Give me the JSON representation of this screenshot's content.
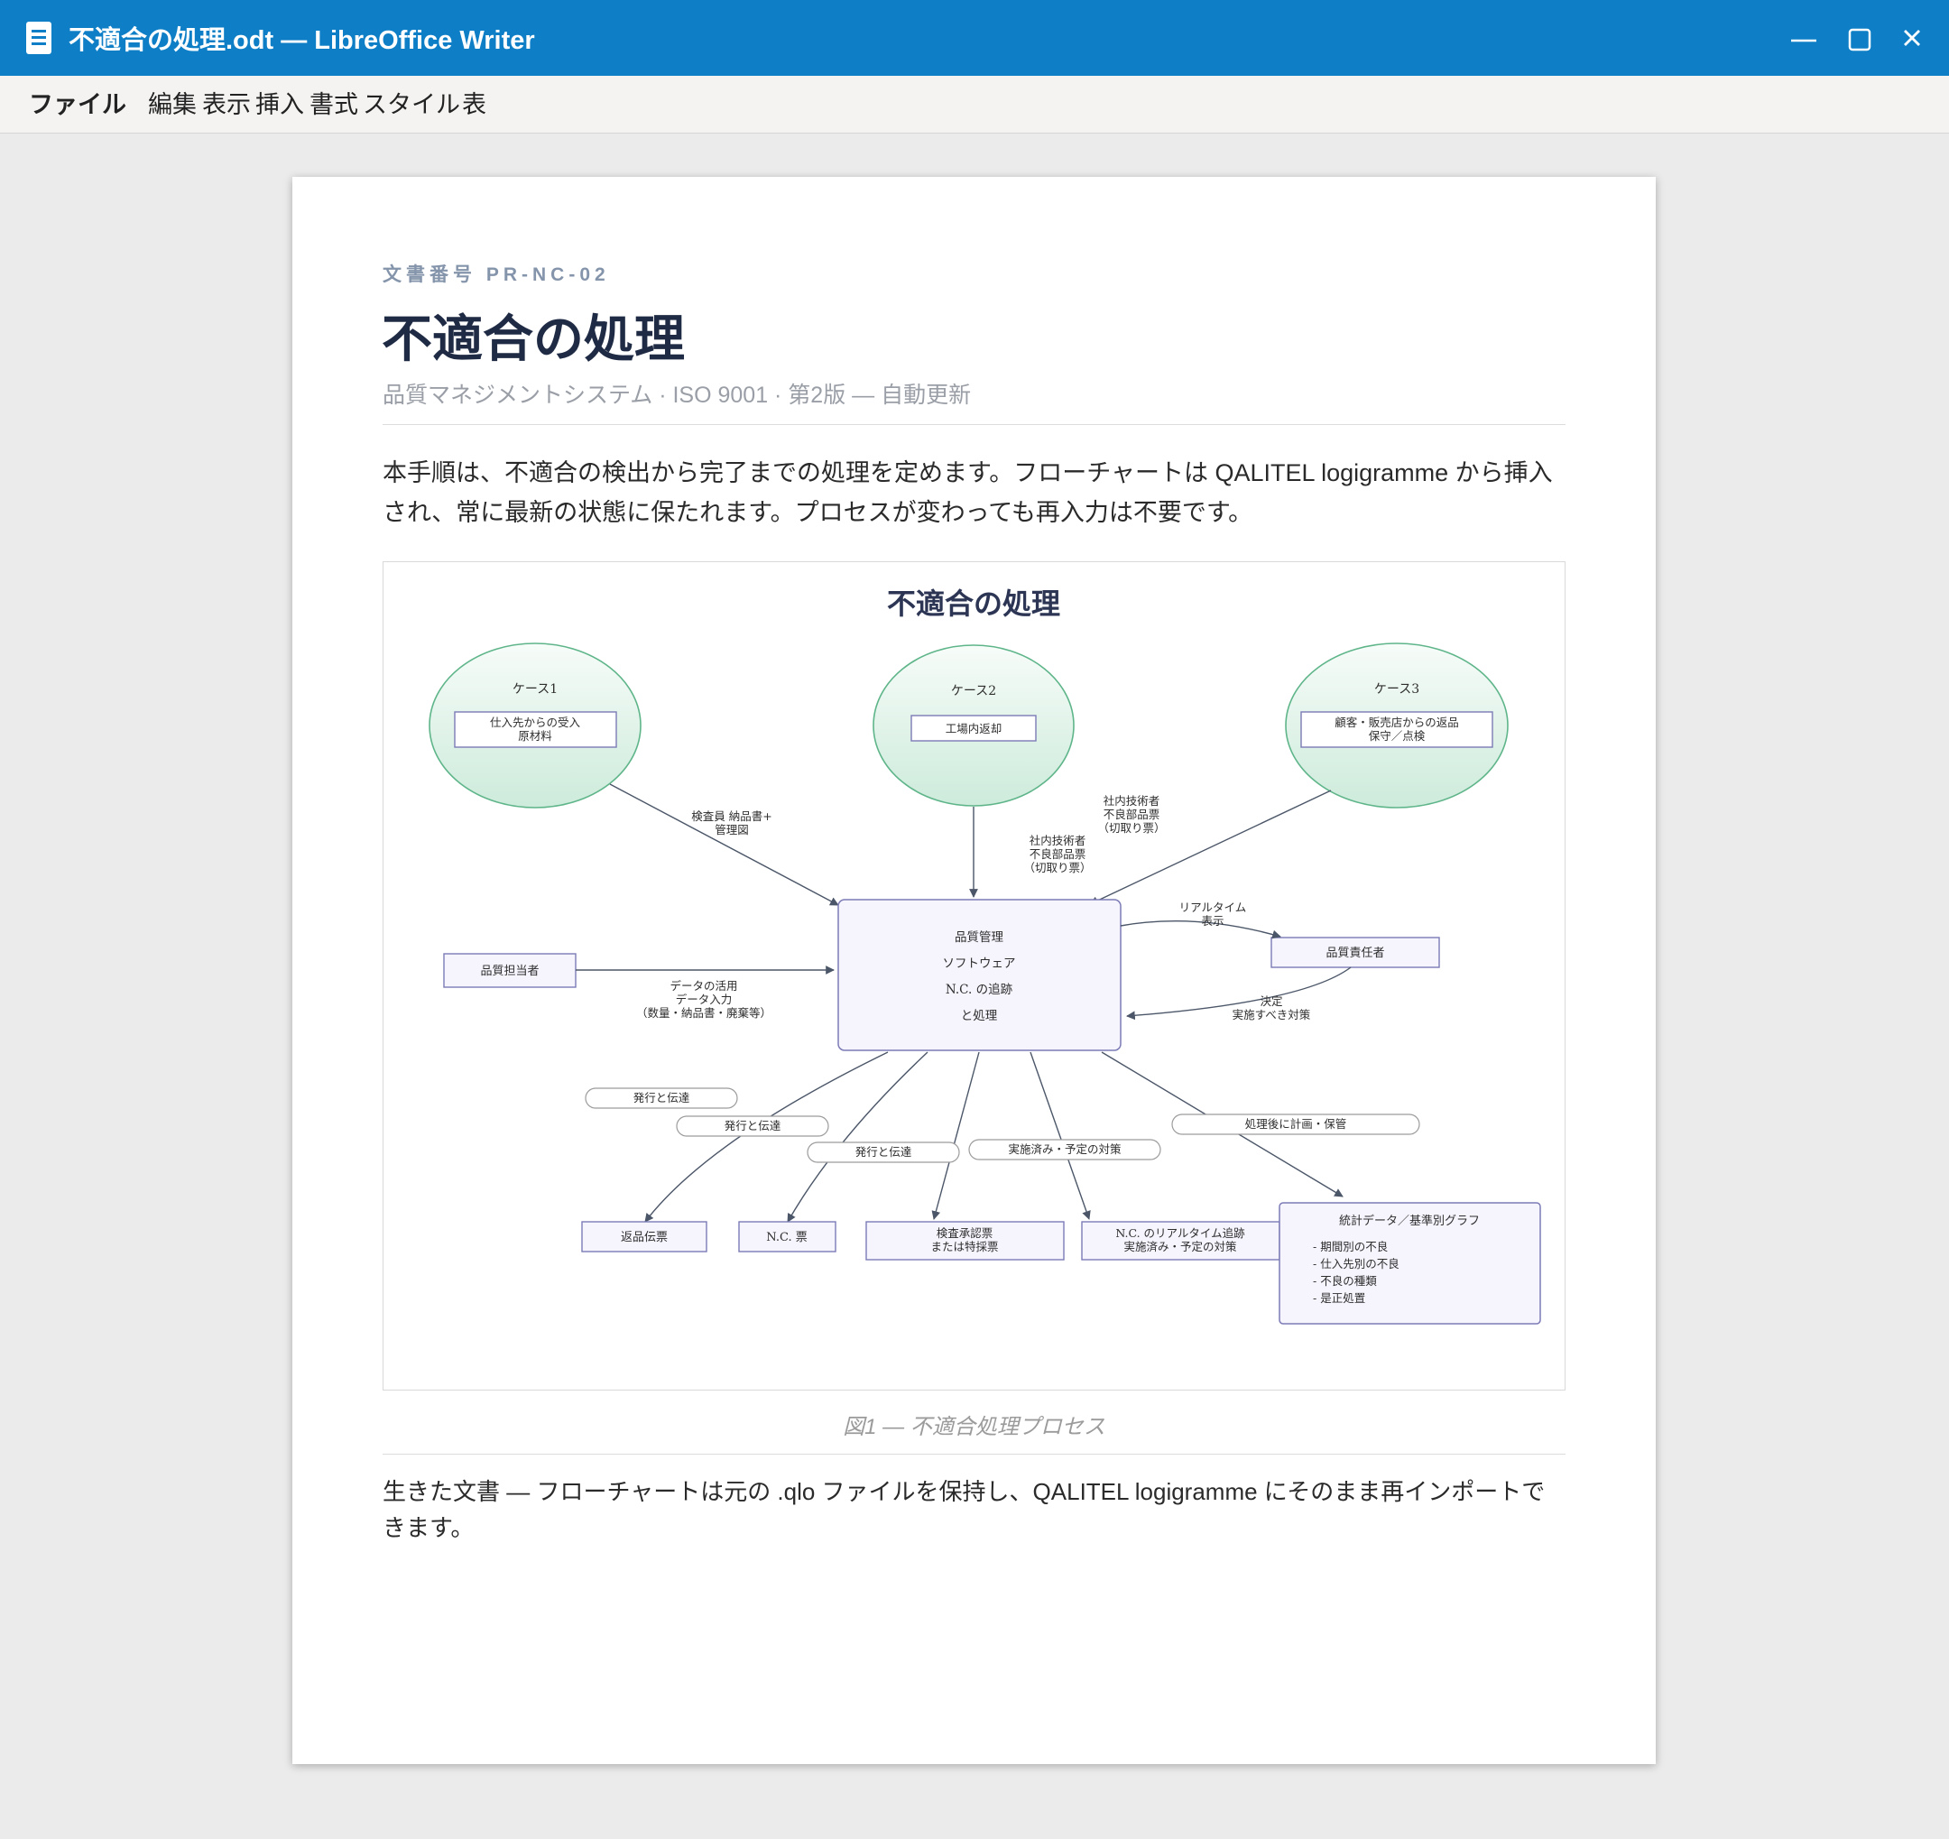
{
  "window": {
    "title": "不適合の処理.odt — LibreOffice Writer"
  },
  "menu": {
    "file": "ファイル",
    "edit": "編集",
    "view": "表示",
    "insert": "挿入",
    "format": "書式",
    "styles": "スタイル",
    "table": "表"
  },
  "doc": {
    "doc_number": "文書番号 PR-NC-02",
    "title": "不適合の処理",
    "subtitle": "品質マネジメントシステム · ISO 9001 · 第2版 — 自動更新",
    "intro": "本手順は、不適合の検出から完了までの処理を定めます。フローチャートは QALITEL logigramme から挿入され、常に最新の状態に保たれます。プロセスが変わっても再入力は不要です。",
    "caption": "図1 — 不適合処理プロセス",
    "outro": "生きた文書 — フローチャートは元の .qlo ファイルを保持し、QALITEL logigramme にそのまま再インポートできます。"
  },
  "flowchart": {
    "title": "不適合の処理",
    "case1": {
      "name": "ケース1",
      "l1": "仕入先からの受入",
      "l2": "原材料"
    },
    "case2": {
      "name": "ケース2",
      "l1": "工場内返却"
    },
    "case3": {
      "name": "ケース3",
      "l1": "顧客・販売店からの返品",
      "l2": "保守／点検"
    },
    "edge_case1": {
      "l1": "検査員 納品書+",
      "l2": "管理図"
    },
    "edge_case2": {
      "l1": "社内技術者",
      "l2": "不良部品票",
      "l3": "（切取り票）"
    },
    "edge_case3": {
      "l1": "社内技術者",
      "l2": "不良部品票",
      "l3": "（切取り票）"
    },
    "center": {
      "l1": "品質管理",
      "l2": "ソフトウェア",
      "l3": "N.C. の追跡",
      "l4": "と処理"
    },
    "qa_staff": "品質担当者",
    "edge_staff": {
      "l1": "データの活用",
      "l2": "データ入力",
      "l3": "（数量・納品書・廃棄等）"
    },
    "qa_manager": "品質責任者",
    "edge_realtime": {
      "l1": "リアルタイム",
      "l2": "表示"
    },
    "edge_decision": {
      "l1": "決定",
      "l2": "実施すべき対策"
    },
    "pills": {
      "p1": "発行と伝達",
      "p2": "発行と伝達",
      "p3": "発行と伝達",
      "p4": "実施済み・予定の対策",
      "p5": "処理後に計画・保管"
    },
    "out1": "返品伝票",
    "out2": "N.C. 票",
    "out3": {
      "l1": "検査承認票",
      "l2": "または特採票"
    },
    "out4": {
      "l1": "N.C. のリアルタイム追跡",
      "l2": "実施済み・予定の対策"
    },
    "stats": {
      "title": "統計データ／基準別グラフ",
      "items": [
        "- 期間別の不良",
        "- 仕入先別の不良",
        "- 不良の種類",
        "- 是正処置"
      ]
    }
  }
}
